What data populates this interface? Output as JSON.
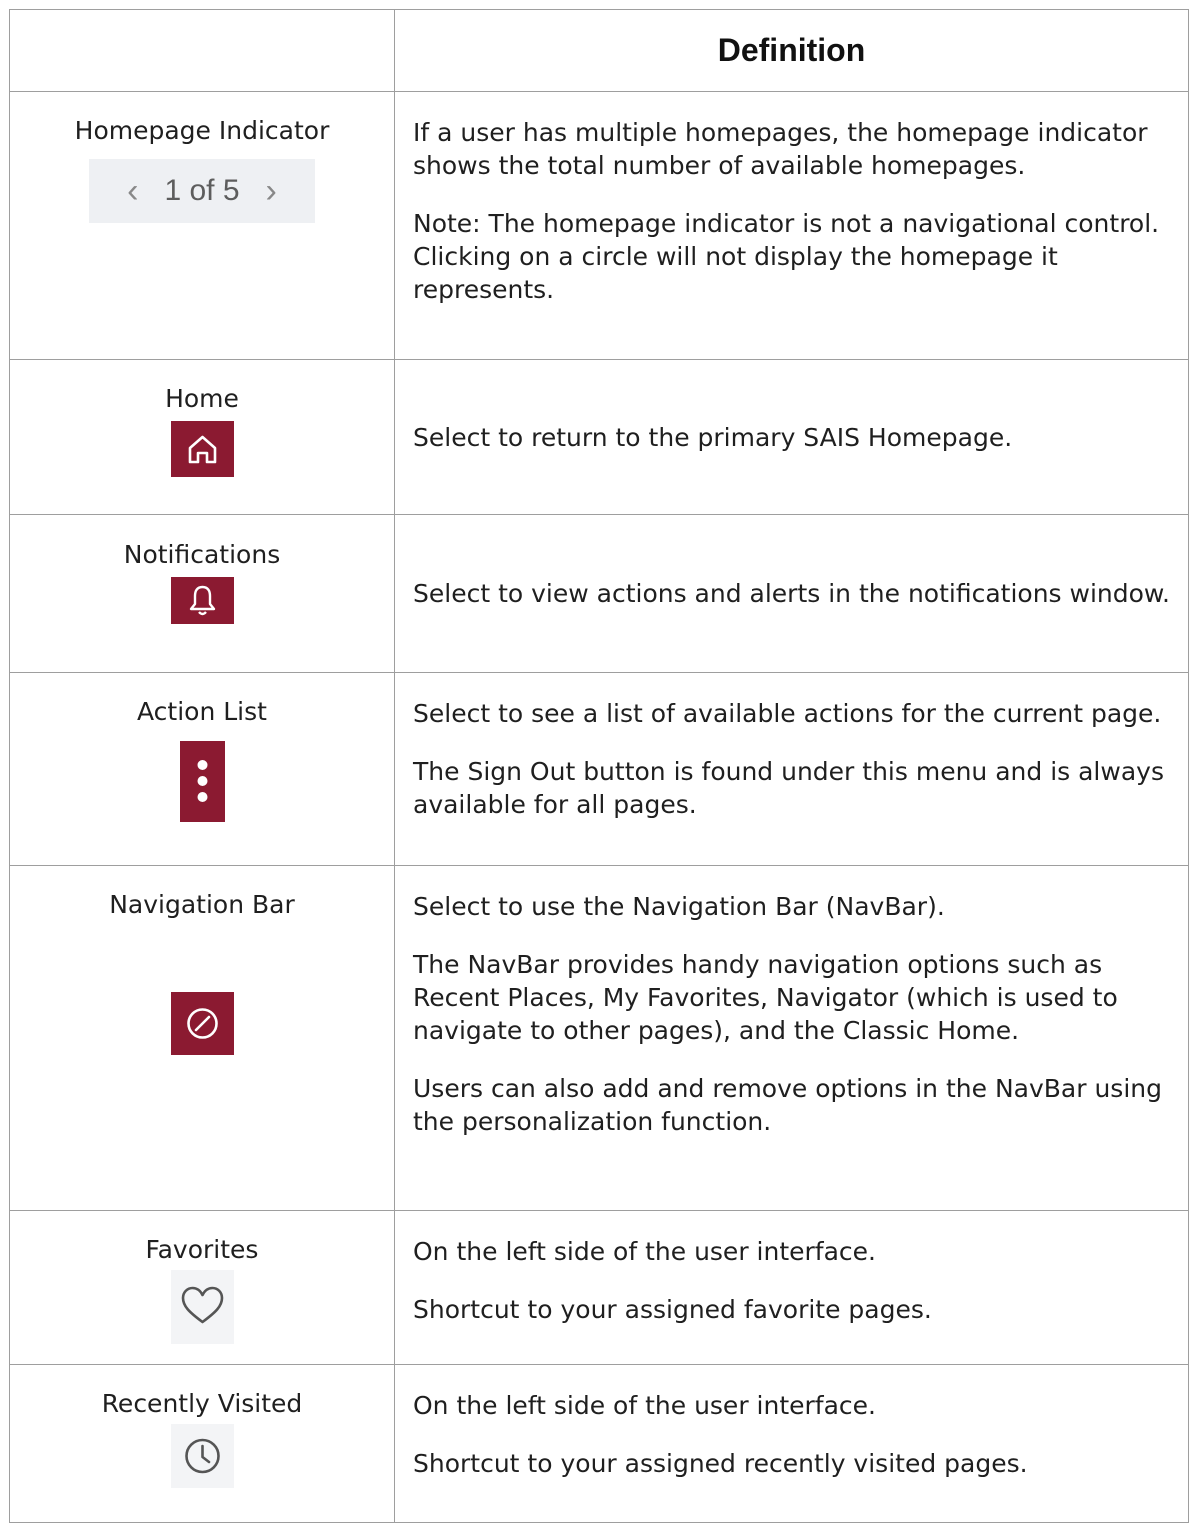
{
  "header": {
    "left": "",
    "right": "Definition"
  },
  "rows": [
    {
      "term": "Homepage Indicator",
      "pager": {
        "prev_icon": "chevron-left",
        "text": "1 of 5",
        "next_icon": "chevron-right"
      },
      "paragraphs": [
        "If a user has multiple homepages, the homepage indicator shows the total number of available homepages.",
        "Note: The homepage indicator is not a navigational control. Clicking on a circle will not display the homepage it represents."
      ]
    },
    {
      "term": "Home",
      "icon": "home-icon",
      "paragraphs": [
        "Select to return to the primary SAIS Homepage."
      ]
    },
    {
      "term": "Notifications",
      "icon": "bell-icon",
      "paragraphs": [
        "Select to view actions and alerts in the notifications window."
      ]
    },
    {
      "term": "Action List",
      "icon": "vertical-ellipsis-icon",
      "paragraphs": [
        "Select to see a list of available actions for the current page.",
        "The Sign Out button is found under this menu and is always available for all pages."
      ]
    },
    {
      "term": "Navigation Bar",
      "icon": "compass-icon",
      "paragraphs": [
        "Select to use the Navigation Bar (NavBar).",
        "The NavBar provides handy navigation options such as Recent Places, My Favorites, Navigator (which is used to navigate to other pages), and the Classic Home.",
        "Users can also add and remove options in the NavBar using the personalization function."
      ]
    },
    {
      "term": "Favorites",
      "icon": "heart-icon",
      "paragraphs": [
        "On the left side of the user interface.",
        "Shortcut to your assigned favorite pages."
      ]
    },
    {
      "term": "Recently Visited",
      "icon": "clock-icon",
      "paragraphs": [
        "On the left side of the user interface.",
        "Shortcut to your assigned recently visited pages."
      ]
    }
  ],
  "colors": {
    "icon_tile": "#8b1a31",
    "grid": "#9e9e9e",
    "pager_bg": "#eef0f3"
  }
}
